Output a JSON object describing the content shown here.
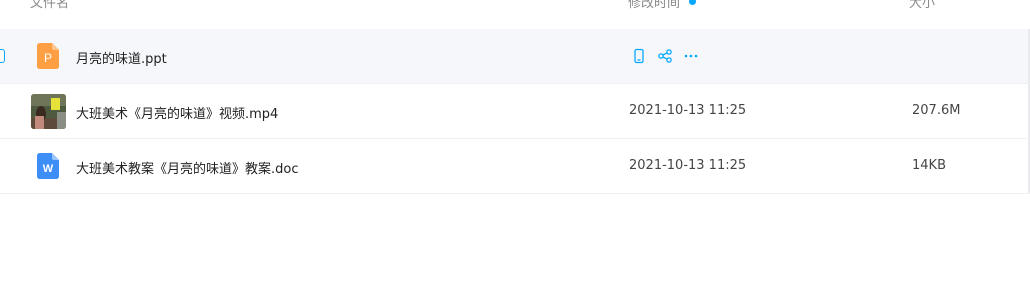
{
  "header": {
    "name_label": "文件名",
    "mtime_label": "修改时间",
    "size_label": "大小"
  },
  "files": [
    {
      "name": "月亮的味道.ppt",
      "type": "ppt",
      "icon": "ppt-file-icon",
      "icon_letter": "P",
      "icon_color": "#ff9f43",
      "modified": "",
      "size": ""
    },
    {
      "name": "大班美术《月亮的味道》视频.mp4",
      "type": "mp4",
      "icon": "video-thumbnail",
      "modified": "2021-10-13 11:25",
      "size": "207.6M"
    },
    {
      "name": "大班美术教案《月亮的味道》教案.doc",
      "type": "doc",
      "icon": "word-file-icon",
      "icon_letter": "W",
      "icon_color": "#3d8ef7",
      "modified": "2021-10-13 11:25",
      "size": "14KB"
    }
  ],
  "row_actions": [
    "phone-icon",
    "share-icon",
    "more-icon"
  ],
  "colors": {
    "accent": "#06a7ff",
    "hover_row": "#f6f7fb"
  }
}
